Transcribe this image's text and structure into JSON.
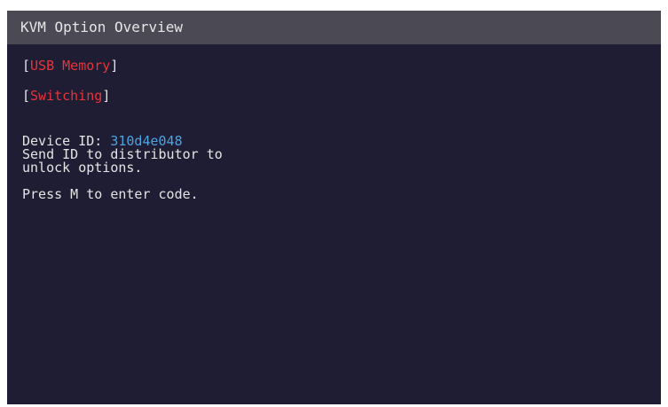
{
  "window": {
    "title": "KVM Option Overview"
  },
  "menu": {
    "options": [
      {
        "label": "USB Memory",
        "bracket_open": "[",
        "bracket_close": "]"
      },
      {
        "label": "Switching",
        "bracket_open": "[",
        "bracket_close": "]"
      }
    ]
  },
  "info": {
    "device_id_label": "Device ID: ",
    "device_id_value": "310d4e048",
    "line_2": "Send ID to distributor to",
    "line_3": "unlock options.",
    "prompt": "Press M to enter code."
  },
  "colors": {
    "background": "#1e1d33",
    "titlebar": "#4a4954",
    "option_label": "#e8343a",
    "device_id_value": "#4fa3e0",
    "text": "#e4e4e4"
  }
}
